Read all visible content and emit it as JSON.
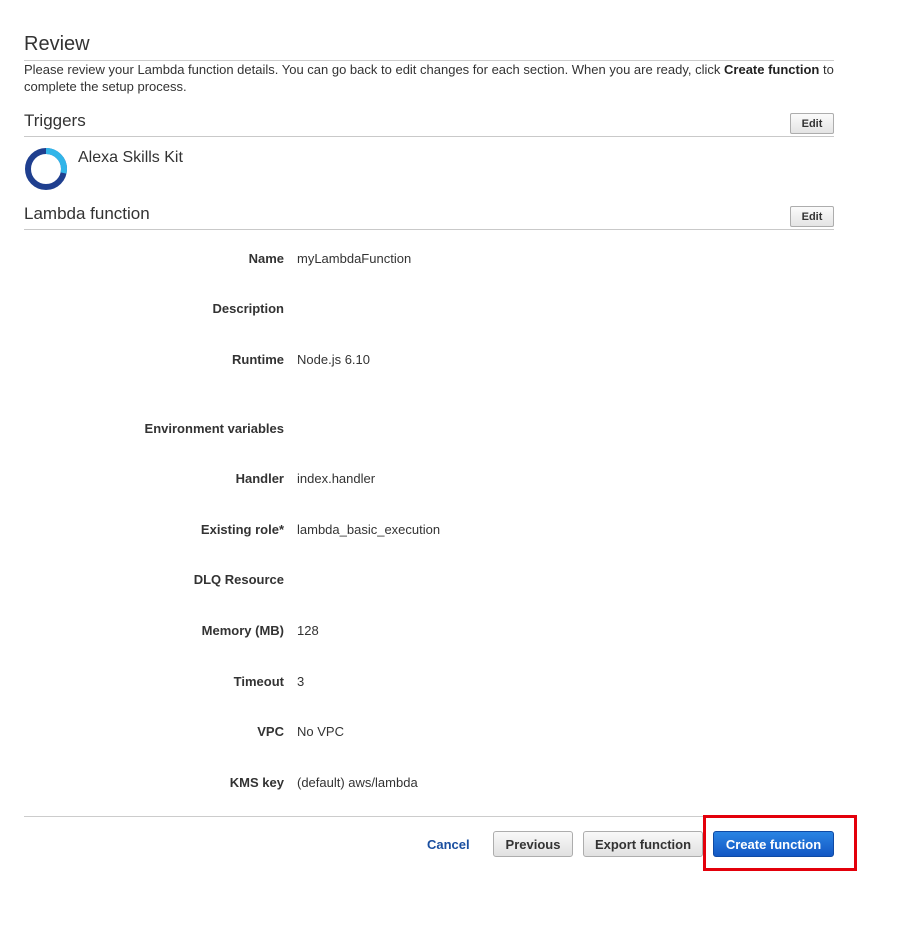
{
  "header": {
    "title": "Review",
    "intro_text": "Please review your Lambda function details. You can go back to edit changes for each section. When you are ready, click ",
    "intro_emphasis": "Create function",
    "intro_text_end": " to complete the setup process."
  },
  "triggers": {
    "title": "Triggers",
    "edit_label": "Edit",
    "items": [
      {
        "label": "Alexa Skills Kit",
        "icon": "alexa-ring-icon"
      }
    ]
  },
  "lambda_function": {
    "title": "Lambda function",
    "edit_label": "Edit",
    "fields": [
      {
        "label": "Name",
        "value": "myLambdaFunction"
      },
      {
        "label": "Description",
        "value": ""
      },
      {
        "label": "Runtime",
        "value": "Node.js 6.10"
      },
      {
        "label": "Environment variables",
        "value": ""
      },
      {
        "label": "Handler",
        "value": "index.handler"
      },
      {
        "label": "Existing role*",
        "value": "lambda_basic_execution"
      },
      {
        "label": "DLQ Resource",
        "value": ""
      },
      {
        "label": "Memory (MB)",
        "value": "128"
      },
      {
        "label": "Timeout",
        "value": "3"
      },
      {
        "label": "VPC",
        "value": "No VPC"
      },
      {
        "label": "KMS key",
        "value": "(default) aws/lambda"
      }
    ]
  },
  "footer": {
    "cancel_label": "Cancel",
    "previous_label": "Previous",
    "export_label": "Export function",
    "create_label": "Create function"
  },
  "colors": {
    "primary_button": "#1357c4",
    "link": "#1a4fa0",
    "highlight": "#e3000b",
    "alexa_ring_outer": "#1f3f8f",
    "alexa_ring_inner": "#31b5e9"
  }
}
